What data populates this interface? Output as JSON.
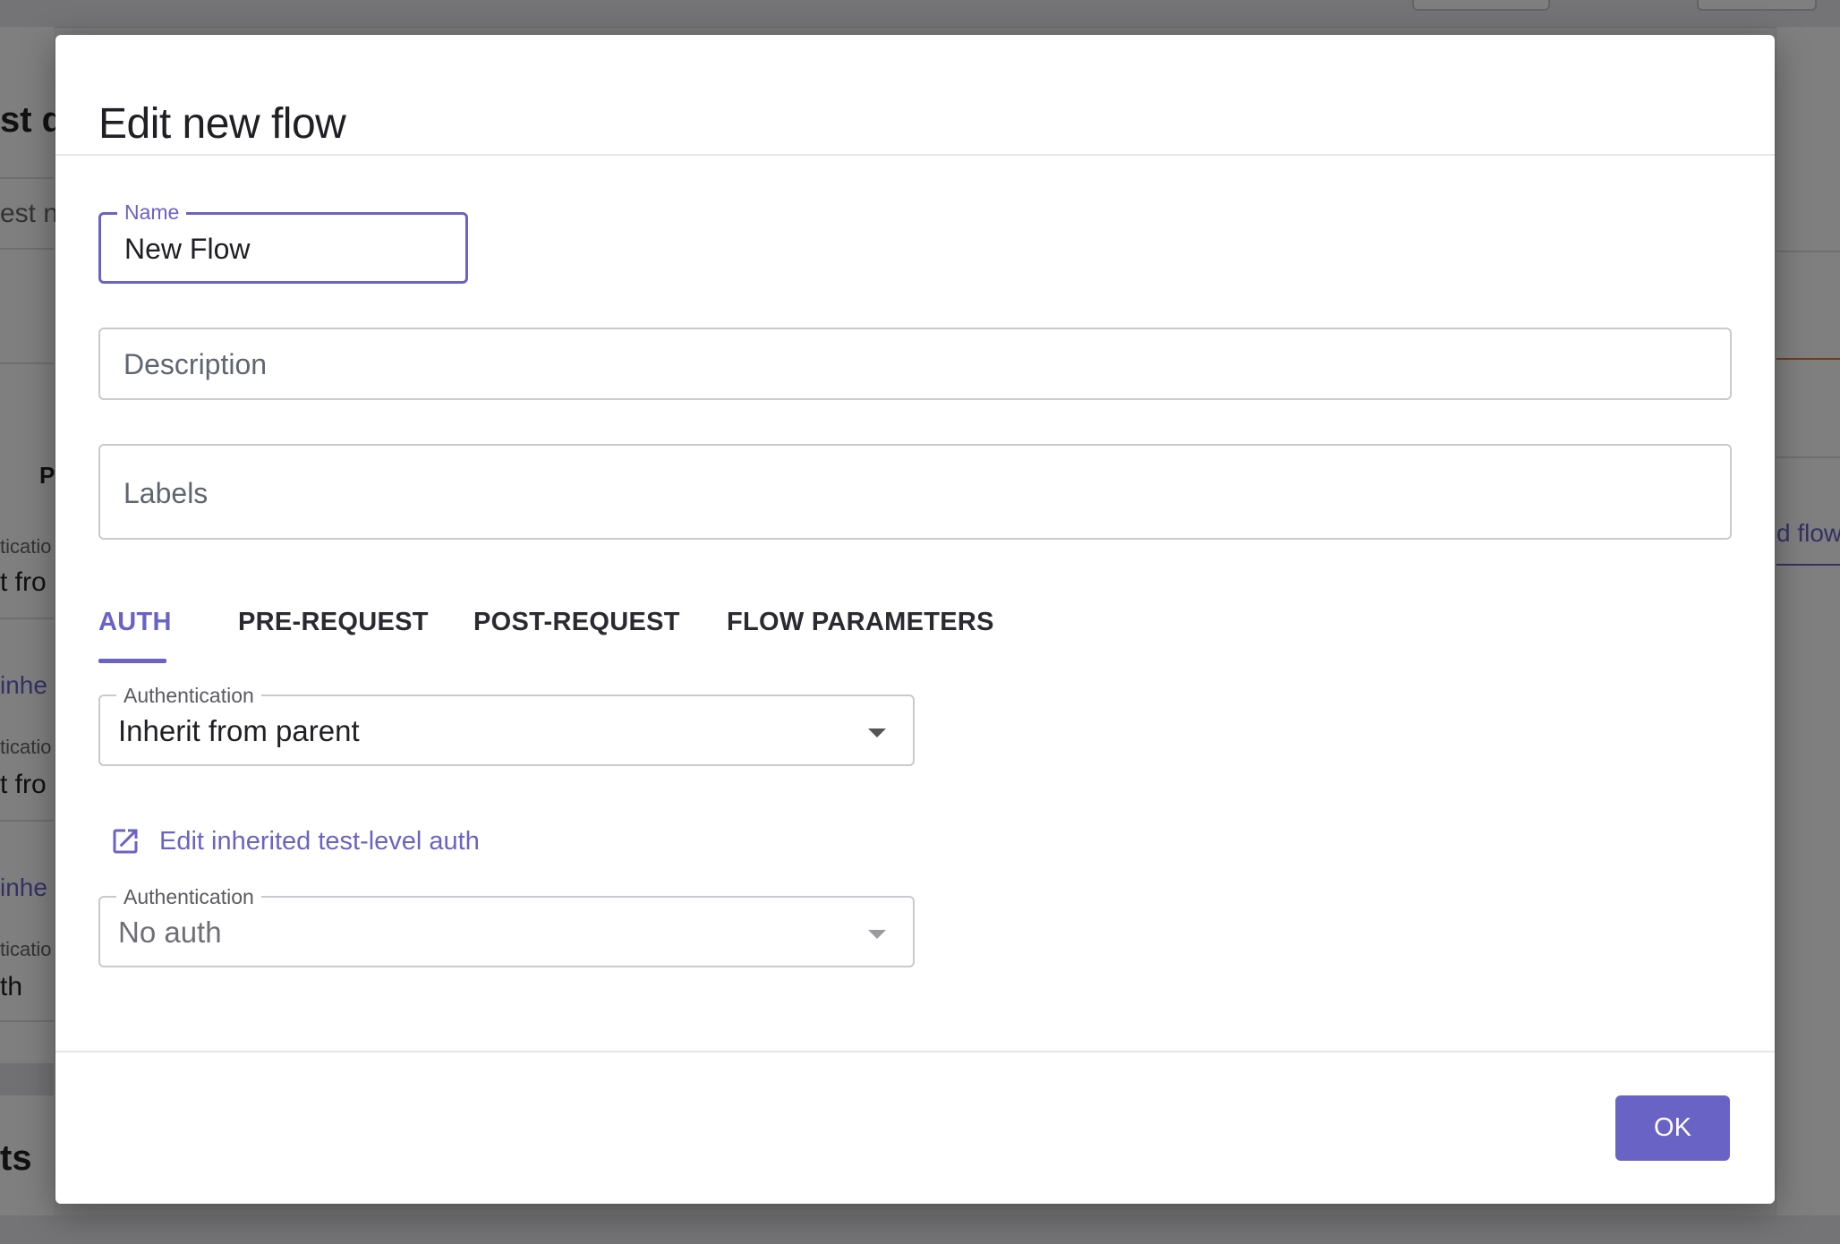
{
  "dialog": {
    "title": "Edit new flow"
  },
  "form": {
    "name": {
      "label": "Name",
      "value": "New Flow"
    },
    "description": {
      "placeholder": "Description",
      "value": ""
    },
    "labels": {
      "placeholder": "Labels",
      "value": ""
    }
  },
  "tabs": [
    {
      "label": "AUTH",
      "active": true
    },
    {
      "label": "PRE-REQUEST",
      "active": false
    },
    {
      "label": "POST-REQUEST",
      "active": false
    },
    {
      "label": "FLOW PARAMETERS",
      "active": false
    }
  ],
  "auth": {
    "primary": {
      "label": "Authentication",
      "value": "Inherit from parent"
    },
    "edit_link": {
      "label": "Edit inherited test-level auth",
      "icon": "open-in-new-icon"
    },
    "secondary": {
      "label": "Authentication",
      "value": "No auth",
      "disabled": true
    }
  },
  "footer": {
    "ok_label": "OK"
  },
  "background": {
    "left_fragments": [
      "st d",
      "est n",
      "P",
      "ticatio",
      "t fro",
      "inhe",
      "ticatio",
      "t fro",
      "inhe",
      "ticatio",
      "th",
      "ts"
    ],
    "right_fragments": [
      "d flow"
    ]
  },
  "colors": {
    "accent": "#6a63c6",
    "scrim": "rgba(0,0,0,0.5)",
    "border": "#c9c9ce"
  }
}
